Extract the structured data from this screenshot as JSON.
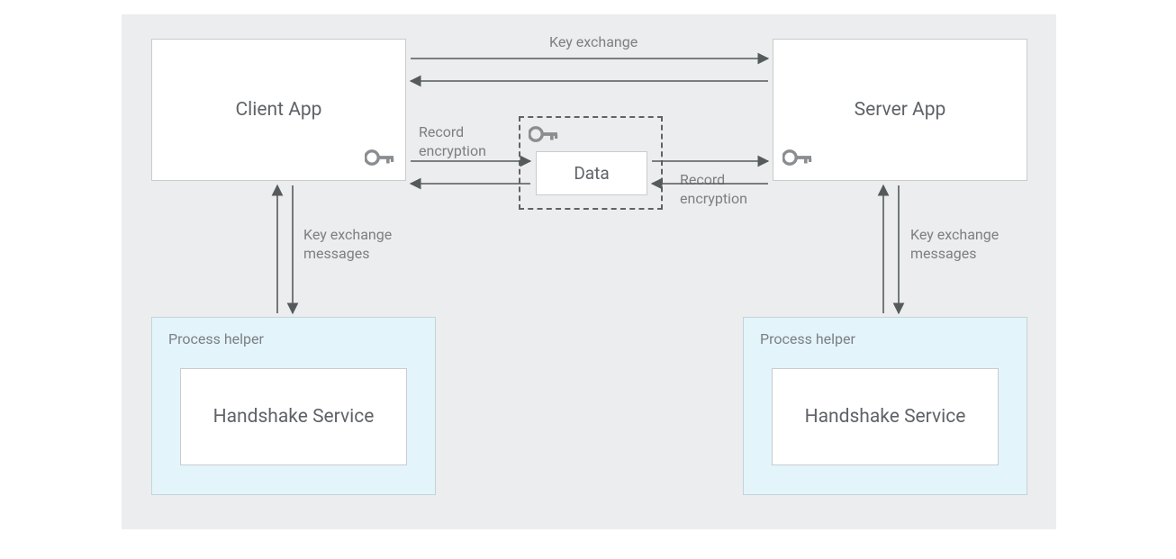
{
  "nodes": {
    "client_app": "Client App",
    "server_app": "Server App",
    "data": "Data",
    "process_helper_left": "Process helper",
    "process_helper_right": "Process helper",
    "handshake_left": "Handshake Service",
    "handshake_right": "Handshake Service"
  },
  "edges": {
    "key_exchange": "Key exchange",
    "record_encryption_left": "Record\nencryption",
    "record_encryption_right": "Record\nencryption",
    "key_exchange_messages_left": "Key exchange\nmessages",
    "key_exchange_messages_right": "Key exchange\nmessages"
  },
  "colors": {
    "panel_bg": "#ebedee",
    "box_border": "#c9cccd",
    "helper_bg": "#e3f4fb",
    "arrow": "#555a5d",
    "text": "#5f6367",
    "icon": "#8a8e91"
  }
}
